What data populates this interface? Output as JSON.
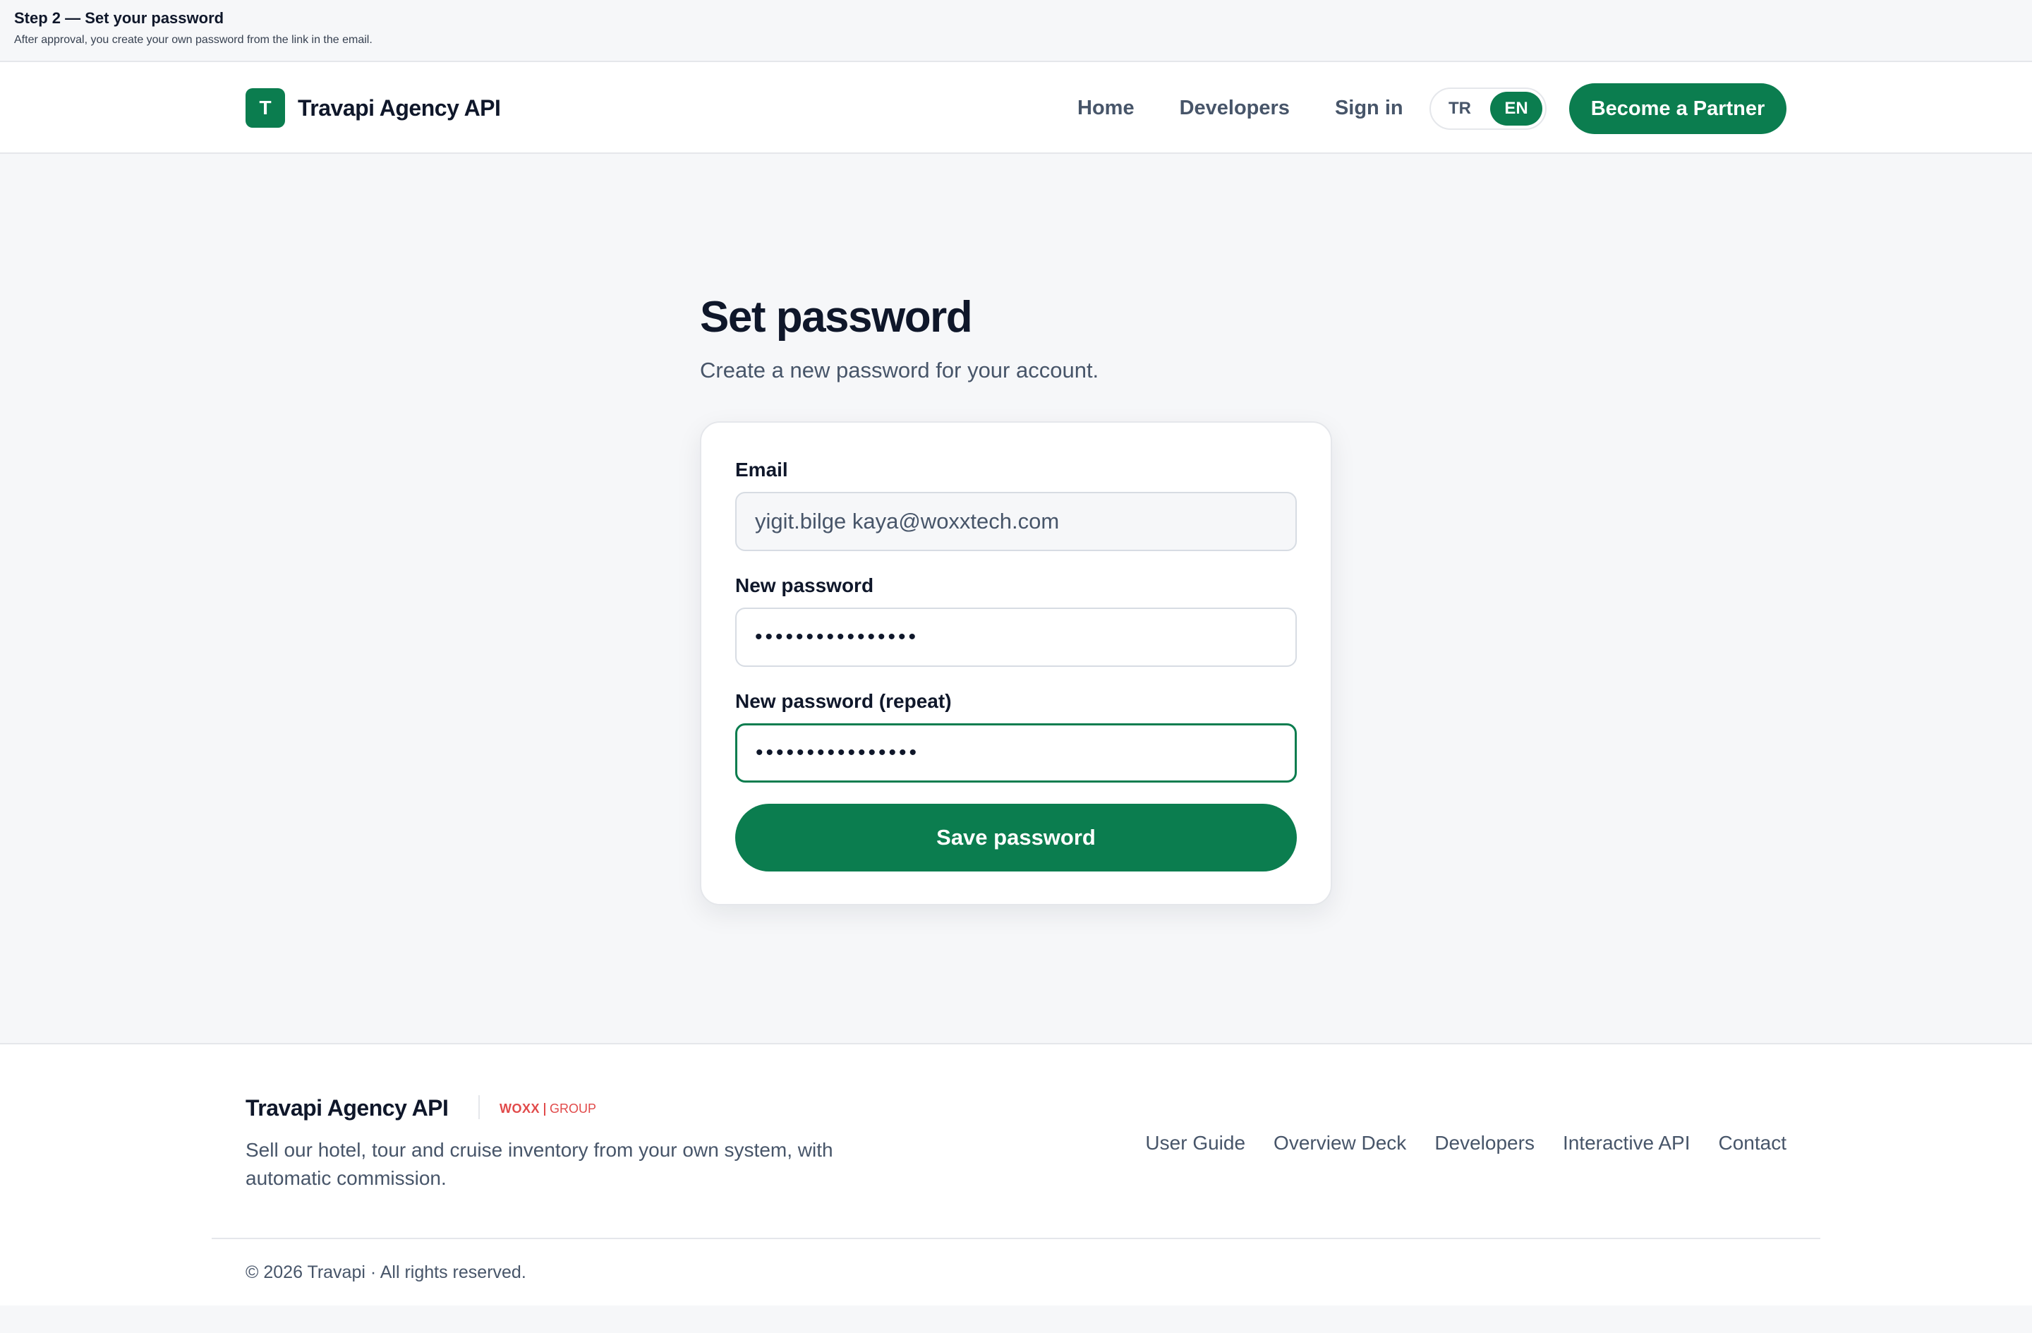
{
  "step": {
    "title": "Step 2 — Set your password",
    "subtitle": "After approval, you create your own password from the link in the email."
  },
  "header": {
    "logo_letter": "T",
    "brand": "Travapi Agency API",
    "nav": [
      {
        "label": "Home"
      },
      {
        "label": "Developers"
      },
      {
        "label": "Sign in"
      }
    ],
    "languages": [
      {
        "code": "TR",
        "active": false
      },
      {
        "code": "EN",
        "active": true
      }
    ],
    "cta": "Become a Partner"
  },
  "main": {
    "title": "Set password",
    "subtitle": "Create a new password for your account."
  },
  "form": {
    "email_label": "Email",
    "email_value": "yigit.bilge kaya@woxxtech.com",
    "password_label": "New password",
    "password_mask": "••••••••••••••••",
    "repeat_label": "New password (repeat)",
    "repeat_mask": "••••••••••••••••",
    "submit": "Save password"
  },
  "footer": {
    "brand": "Travapi Agency API",
    "partner_logo_left": "WOXX",
    "partner_logo_right": "GROUP",
    "description": "Sell our hotel, tour and cruise inventory from your own system, with automatic commission.",
    "links": [
      {
        "label": "User Guide"
      },
      {
        "label": "Overview Deck"
      },
      {
        "label": "Developers"
      },
      {
        "label": "Interactive API"
      },
      {
        "label": "Contact"
      }
    ],
    "copyright": "© 2026 Travapi · All rights reserved."
  },
  "colors": {
    "accent": "#0b7d4f",
    "partner_red": "#e14a4a",
    "text_primary": "#0f172a",
    "text_secondary": "#475569",
    "background": "#f6f7f9"
  }
}
